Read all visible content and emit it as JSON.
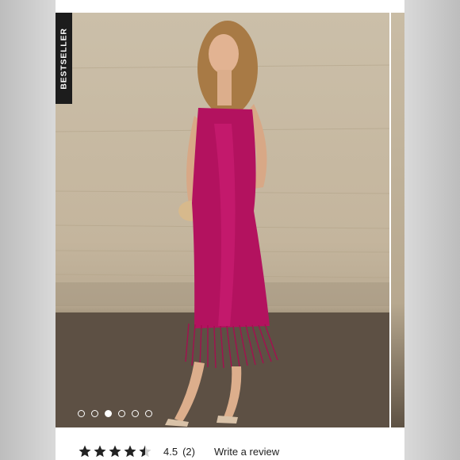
{
  "badge": {
    "text": "BESTSELLER"
  },
  "carousel": {
    "total_slides": 6,
    "active_index": 2
  },
  "rating": {
    "value": "4.5",
    "count": "(2)",
    "stars_filled": 4.5,
    "stars_total": 5,
    "review_link": "Write a review"
  },
  "colors": {
    "dress": "#b3125f",
    "wall": "#c7b9a1",
    "floor": "#5b4f42",
    "badge_bg": "#1c1c1c",
    "star": "#222222"
  },
  "icons": {
    "badge": "bestseller-label",
    "star": "star-icon",
    "dot": "carousel-dot"
  }
}
